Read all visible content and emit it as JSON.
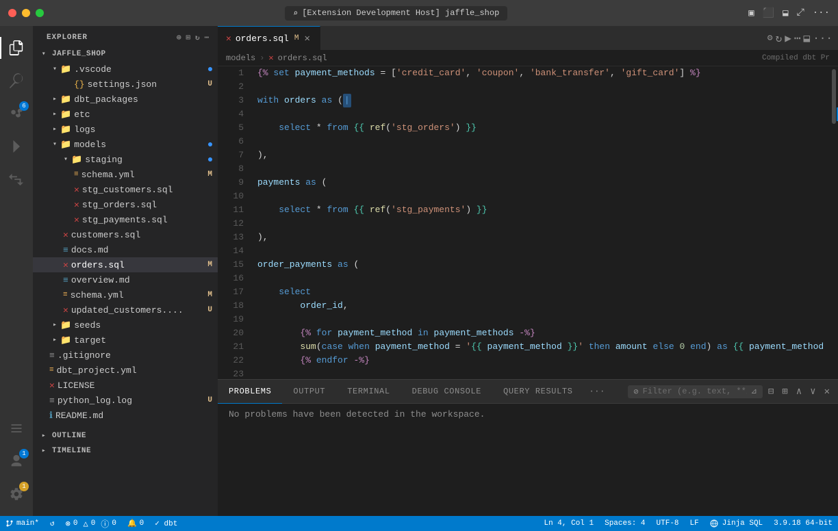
{
  "titlebar": {
    "title": "[Extension Development Host] jaffle_shop",
    "search_placeholder": "[Extension Development Host] jaffle_shop"
  },
  "activity_bar": {
    "items": [
      {
        "name": "explorer",
        "icon": "⬜",
        "active": true
      },
      {
        "name": "search",
        "icon": "🔍",
        "active": false
      },
      {
        "name": "source-control",
        "icon": "⑂",
        "active": false,
        "badge": "6"
      },
      {
        "name": "run",
        "icon": "▷",
        "active": false
      },
      {
        "name": "extensions",
        "icon": "⧉",
        "active": false
      }
    ],
    "bottom_items": [
      {
        "name": "remote",
        "icon": "⊞",
        "active": false
      },
      {
        "name": "account",
        "icon": "👤",
        "active": false,
        "badge": "1"
      },
      {
        "name": "settings",
        "icon": "⚙",
        "active": false,
        "badge": "1"
      }
    ]
  },
  "sidebar": {
    "title": "EXPLORER",
    "project": "JAFFLE_SHOP",
    "tree": [
      {
        "indent": 0,
        "type": "folder",
        "open": true,
        "name": ".vscode",
        "badge": "",
        "dot": true
      },
      {
        "indent": 1,
        "type": "file",
        "name": "settings.json",
        "badge": "U",
        "dot": false
      },
      {
        "indent": 0,
        "type": "folder",
        "open": false,
        "name": "dbt_packages",
        "badge": "",
        "dot": false
      },
      {
        "indent": 0,
        "type": "folder",
        "open": false,
        "name": "etc",
        "badge": "",
        "dot": false
      },
      {
        "indent": 0,
        "type": "folder",
        "open": false,
        "name": "logs",
        "badge": "",
        "dot": false
      },
      {
        "indent": 0,
        "type": "folder",
        "open": true,
        "name": "models",
        "badge": "",
        "dot": true
      },
      {
        "indent": 1,
        "type": "folder",
        "open": true,
        "name": "staging",
        "badge": "",
        "dot": true
      },
      {
        "indent": 2,
        "type": "file",
        "name": "schema.yml",
        "badge": "M",
        "dot": false,
        "icon": "yml"
      },
      {
        "indent": 2,
        "type": "file",
        "name": "stg_customers.sql",
        "badge": "",
        "dot": false,
        "icon": "dbt"
      },
      {
        "indent": 2,
        "type": "file",
        "name": "stg_orders.sql",
        "badge": "",
        "dot": false,
        "icon": "dbt"
      },
      {
        "indent": 2,
        "type": "file",
        "name": "stg_payments.sql",
        "badge": "",
        "dot": false,
        "icon": "dbt"
      },
      {
        "indent": 1,
        "type": "file",
        "name": "customers.sql",
        "badge": "",
        "dot": false,
        "icon": "dbt"
      },
      {
        "indent": 1,
        "type": "file",
        "name": "docs.md",
        "badge": "",
        "dot": false,
        "icon": "md"
      },
      {
        "indent": 1,
        "type": "file",
        "name": "orders.sql",
        "badge": "M",
        "dot": false,
        "icon": "dbt",
        "selected": true
      },
      {
        "indent": 1,
        "type": "file",
        "name": "overview.md",
        "badge": "",
        "dot": false,
        "icon": "md"
      },
      {
        "indent": 1,
        "type": "file",
        "name": "schema.yml",
        "badge": "M",
        "dot": false,
        "icon": "yml"
      },
      {
        "indent": 1,
        "type": "file",
        "name": "updated_customers....",
        "badge": "U",
        "dot": false,
        "icon": "dbt"
      },
      {
        "indent": 0,
        "type": "folder",
        "open": false,
        "name": "seeds",
        "badge": "",
        "dot": false
      },
      {
        "indent": 0,
        "type": "folder",
        "open": false,
        "name": "target",
        "badge": "",
        "dot": false
      },
      {
        "indent": 0,
        "type": "file",
        "name": ".gitignore",
        "badge": "",
        "dot": false,
        "icon": "txt"
      },
      {
        "indent": 0,
        "type": "file",
        "name": "dbt_project.yml",
        "badge": "",
        "dot": false,
        "icon": "yml"
      },
      {
        "indent": 0,
        "type": "file",
        "name": "LICENSE",
        "badge": "",
        "dot": false,
        "icon": "txt"
      },
      {
        "indent": 0,
        "type": "file",
        "name": "python_log.log",
        "badge": "U",
        "dot": false,
        "icon": "log"
      },
      {
        "indent": 0,
        "type": "file",
        "name": "README.md",
        "badge": "",
        "dot": false,
        "icon": "md"
      }
    ],
    "outline_label": "OUTLINE",
    "timeline_label": "TIMELINE"
  },
  "editor": {
    "tab_label": "orders.sql",
    "tab_modified": "M",
    "breadcrumb_models": "models",
    "breadcrumb_file": "orders.sql",
    "compiled_label": "Compiled dbt Pr",
    "lines": [
      {
        "num": 1,
        "code": "{% set payment_methods = ['credit_card', 'coupon', 'bank_transfer', 'gift_card'] %}"
      },
      {
        "num": 2,
        "code": ""
      },
      {
        "num": 3,
        "code": "with orders as ("
      },
      {
        "num": 4,
        "code": ""
      },
      {
        "num": 5,
        "code": "    select * from {{ ref('stg_orders') }}"
      },
      {
        "num": 6,
        "code": ""
      },
      {
        "num": 7,
        "code": "),"
      },
      {
        "num": 8,
        "code": ""
      },
      {
        "num": 9,
        "code": "payments as ("
      },
      {
        "num": 10,
        "code": ""
      },
      {
        "num": 11,
        "code": "    select * from {{ ref('stg_payments') }}"
      },
      {
        "num": 12,
        "code": ""
      },
      {
        "num": 13,
        "code": "),"
      },
      {
        "num": 14,
        "code": ""
      },
      {
        "num": 15,
        "code": "order_payments as ("
      },
      {
        "num": 16,
        "code": ""
      },
      {
        "num": 17,
        "code": "    select"
      },
      {
        "num": 18,
        "code": "        order_id,"
      },
      {
        "num": 19,
        "code": ""
      },
      {
        "num": 20,
        "code": "        {% for payment_method in payment_methods -%}"
      },
      {
        "num": 21,
        "code": "        sum(case when payment_method = '{{ payment_method }}' then amount else 0 end) as {{ payment_method }}_amou"
      },
      {
        "num": 22,
        "code": "        {% endfor -%}"
      },
      {
        "num": 23,
        "code": ""
      }
    ]
  },
  "panel": {
    "tabs": [
      {
        "label": "PROBLEMS",
        "active": true
      },
      {
        "label": "OUTPUT",
        "active": false
      },
      {
        "label": "TERMINAL",
        "active": false
      },
      {
        "label": "DEBUG CONSOLE",
        "active": false
      },
      {
        "label": "QUERY RESULTS",
        "active": false
      }
    ],
    "filter_placeholder": "Filter (e.g. text, **/*t...",
    "problems_text": "No problems have been detected in the workspace."
  },
  "statusbar": {
    "branch": "main*",
    "sync_icon": "↺",
    "errors": "0",
    "warnings": "0",
    "info": "0",
    "no_problems": "0",
    "dbt_check": "✓ dbt",
    "line_col": "Ln 4, Col 1",
    "spaces": "Spaces: 4",
    "encoding": "UTF-8",
    "eol": "LF",
    "language": "Jinja SQL",
    "version": "3.9.18 64-bit"
  }
}
